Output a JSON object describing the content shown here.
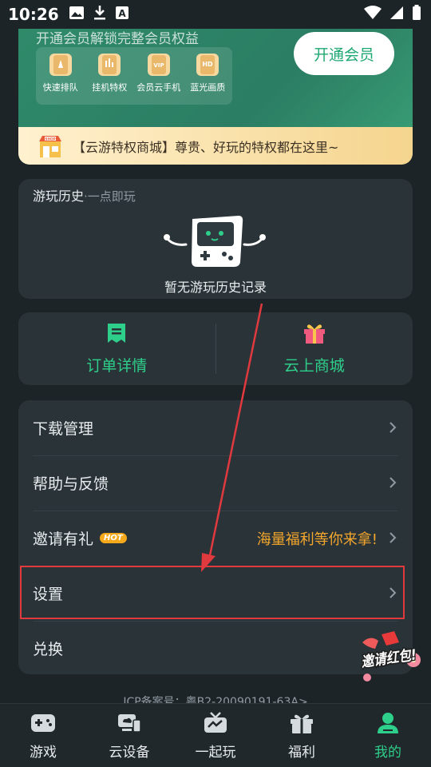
{
  "status": {
    "time": "10:26",
    "icons_left": [
      "image-icon",
      "download-icon",
      "accessibility-icon"
    ],
    "icons_right": [
      "wifi-icon",
      "signal-icon",
      "battery-icon"
    ]
  },
  "member": {
    "subtitle": "开通会员解锁完整会员权益",
    "open_button": "开通会员",
    "perks": [
      {
        "label": "快速排队",
        "icon": "rocket-phone-icon"
      },
      {
        "label": "挂机特权",
        "icon": "hangup-phone-icon"
      },
      {
        "label": "会员云手机",
        "icon": "vip-phone-icon"
      },
      {
        "label": "蓝光画质",
        "icon": "hd-phone-icon"
      }
    ],
    "shop_text": "【云游特权商城】尊贵、好玩的特权都在这里~",
    "shop_icon_label": "SHOP"
  },
  "history": {
    "title": "游玩历史",
    "subtitle": "·一点即玩",
    "empty": "暂无游玩历史记录"
  },
  "actions": [
    {
      "label": "订单详情",
      "icon": "order-icon"
    },
    {
      "label": "云上商城",
      "icon": "gift-icon"
    }
  ],
  "menu": [
    {
      "label": "下载管理"
    },
    {
      "label": "帮助与反馈"
    },
    {
      "label": "邀请有礼",
      "badge": "HOT",
      "promo": "海量福利等你来拿!"
    },
    {
      "label": "设置"
    },
    {
      "label": "兑换"
    }
  ],
  "icp": "ICP备案号：粤B2-20090191-63A>",
  "invite_float": "邀请红包!",
  "nav": [
    {
      "label": "游戏",
      "icon": "gamepad-icon"
    },
    {
      "label": "云设备",
      "icon": "cloud-device-icon"
    },
    {
      "label": "一起玩",
      "icon": "tv-icon"
    },
    {
      "label": "福利",
      "icon": "gift-icon"
    },
    {
      "label": "我的",
      "icon": "profile-icon",
      "active": true
    }
  ],
  "colors": {
    "accent": "#2ecf8a",
    "background": "#1d2428",
    "card": "#2a3338",
    "promo": "#f4a72c",
    "highlight": "#e0393e"
  }
}
